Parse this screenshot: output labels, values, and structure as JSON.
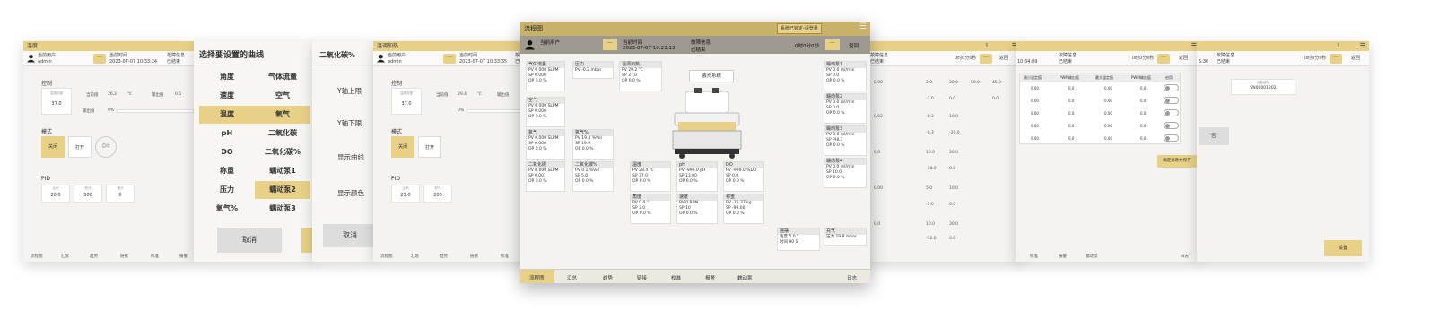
{
  "panel1": {
    "title": "温度",
    "user_label": "当前用户",
    "user": "admin",
    "time_label": "当前时间",
    "time": "2023-07-07 10:33:24",
    "fault_label": "故障信息",
    "fault": "已结束",
    "control_label": "控制",
    "setpoint_label": "温度设置",
    "setpoint": "37.0",
    "current_label": "当前值",
    "current": "26.2",
    "unit": "℃",
    "output_label": "输出值",
    "output": "0.0",
    "output2_label": "输出值",
    "output2": "0%",
    "mode_label": "模式",
    "mode_off": "关闭",
    "mode_on": "打开",
    "mode_auto": "自动",
    "pid_label": "PID",
    "pid_p_label": "比例",
    "pid_p": "20.0",
    "pid_i_label": "积分",
    "pid_i": "500",
    "pid_d_label": "微分",
    "pid_d": "0",
    "nav": [
      "流程图",
      "汇总",
      "趋势",
      "链接",
      "校准",
      "报警"
    ]
  },
  "curve_dialog": {
    "title": "选择要设置的曲线",
    "items": [
      "角度",
      "气体流量",
      "速度",
      "空气",
      "温度",
      "氧气",
      "pH",
      "二氧化碳",
      "DO",
      "二氧化碳%",
      "称重",
      "蠕动泵1",
      "压力",
      "蠕动泵2",
      "氧气%",
      "蠕动泵3"
    ],
    "cancel": "取消"
  },
  "axis_dialog": {
    "title": "二氧化碳%",
    "ymax_label": "Y轴上限",
    "ymin_label": "Y轴下限",
    "show_curve_label": "显示曲线",
    "color_label": "显示颜色",
    "cancel": "取消"
  },
  "panel3": {
    "title": "温调加热",
    "user_label": "当前用户",
    "user": "admin",
    "time_label": "当前时间",
    "time": "2023-07-07 10:33:35",
    "fault_label": "故障信息",
    "fault": "已结束",
    "control_label": "控制",
    "setpoint_label": "温度设置",
    "setpoint": "37.0",
    "current_label": "当前值",
    "current": "29.4",
    "unit": "℃",
    "output_label": "输出值",
    "output": "0%",
    "mode_label": "模式",
    "mode_off": "关闭",
    "mode_on": "打开",
    "pid_label": "PID",
    "pid_p_label": "比例",
    "pid_p": "25.0",
    "pid_i_label": "积分",
    "pid_i": "200",
    "nav": [
      "流程图",
      "汇总",
      "趋势",
      "链接",
      "校准"
    ]
  },
  "main": {
    "title": "流程图",
    "lock_button": "系统已锁定-请登录",
    "user_label": "当前用户",
    "time_label": "当前时间",
    "time": "2023-07-07 10:23:13",
    "fault_label": "故障信息",
    "fault": "已结束",
    "timer": "0时0分0秒",
    "back_button": "返回",
    "device_label": "激光系统",
    "gas_flow": {
      "title": "气体流量",
      "pv": "0.000",
      "sp": "0.000",
      "op": "0.0",
      "unit": "SLPM",
      "op_unit": "%"
    },
    "air": {
      "title": "空气",
      "pv": "0.000",
      "sp": "0.000",
      "op": "0.0",
      "unit": "SLPM",
      "op_unit": "%"
    },
    "oxygen": {
      "title": "氧气",
      "pv": "0.000",
      "sp": "0.000",
      "op": "0.0",
      "unit": "SLPM",
      "op_unit": "%"
    },
    "co2": {
      "title": "二氧化碳",
      "pv": "0.000",
      "sp": "0.001",
      "op": "0.0",
      "unit": "SLPM",
      "op_unit": "%"
    },
    "pressure": {
      "title": "压力",
      "pv": "-0.2",
      "unit": "mbar"
    },
    "oxygen_pct": {
      "title": "氧气%",
      "pv": "19.4",
      "sp": "19.9",
      "op": "0.0",
      "unit": "%Vol",
      "op_unit": "%"
    },
    "co2_pct": {
      "title": "二氧化碳%",
      "pv": "0.1",
      "sp": "5.0",
      "op": "0.0",
      "unit": "%Vol",
      "op_unit": "%"
    },
    "heating": {
      "title": "温调加热",
      "pv": "29.2",
      "sp": "37.0",
      "op": "0.0",
      "unit": "℃",
      "op_unit": "%"
    },
    "temp": {
      "title": "温度",
      "pv": "28.4",
      "sp": "37.0",
      "op": "0.0",
      "unit": "℃",
      "op_unit": "%"
    },
    "ph": {
      "title": "pH",
      "pv": "-999.0",
      "sp": "13.00",
      "op": "0.0",
      "unit": "pH",
      "op_unit": "%"
    },
    "do": {
      "title": "DO",
      "pv": "-999.0",
      "sp": "0.0",
      "op": "0.0",
      "unit": "%DO",
      "op_unit": "%"
    },
    "angle": {
      "title": "角度",
      "pv": "0.0",
      "sp": "3.0",
      "op": "0.0",
      "unit": "°",
      "op_unit": "%"
    },
    "speed": {
      "title": "速度",
      "pv": "0",
      "sp": "10",
      "op": "0.0",
      "unit": "RPM",
      "op_unit": "%"
    },
    "weight": {
      "title": "称重",
      "pv": "-15.37",
      "sp": "-99.00",
      "op": "0.0",
      "unit": "kg",
      "op_unit": "%"
    },
    "pump1": {
      "title": "蠕动泵1",
      "pv": "0.0",
      "sp": "0.0",
      "op": "0.0",
      "unit": "ml/min",
      "op_unit": "%"
    },
    "pump2": {
      "title": "蠕动泵2",
      "pv": "0.0",
      "sp": "0.0",
      "op": "0.0",
      "unit": "ml/min",
      "op_unit": "%"
    },
    "pump3": {
      "title": "蠕动泵3",
      "pv": "0.0",
      "sp": "PHL7",
      "op": "0.0",
      "unit": "ml/min",
      "op_unit": "%"
    },
    "pump4": {
      "title": "蠕动泵4",
      "pv": "0.0",
      "sp": "10.0",
      "op": "0.0",
      "unit": "ml/min",
      "op_unit": "%"
    },
    "rocking": {
      "title": "摇摆",
      "angle_label": "角度",
      "angle": "5.0",
      "angle_unit": "°",
      "time_label": "时间",
      "time": "90",
      "time_unit": "S"
    },
    "inflate": {
      "title": "充气",
      "pressure_label": "压力",
      "pressure": "19.8",
      "unit": "mbar"
    },
    "nav": [
      "流程图",
      "汇总",
      "趋势",
      "链接",
      "校准",
      "报警",
      "蠕动泵"
    ],
    "log": "日志"
  },
  "panel5": {
    "fault_label": "故障信息",
    "fault": "已结束",
    "timer": "0时0分0秒",
    "back": "返回",
    "rows": [
      [
        "0.00",
        "2.0",
        "30.0"
      ],
      [
        "0.02",
        "-2.0",
        "0.0"
      ],
      [
        "0.02",
        "-0.3",
        "10.0"
      ],
      [
        "",
        "-0.3",
        "-20.0"
      ],
      [
        "0.0",
        "10.0",
        "30.0"
      ],
      [
        "",
        "-10.0",
        "0.0"
      ],
      [
        "0.00",
        "5.0",
        "10.0"
      ],
      [
        "",
        "-5.0",
        "0.0"
      ],
      [
        "0.0",
        "10.0",
        "30.0"
      ],
      [
        "",
        "-10.0",
        "0.0"
      ]
    ],
    "extra1": "50.0",
    "extra2": "45.0",
    "extra3": "0.0"
  },
  "panel6": {
    "time": "10:34:09",
    "fault_label": "故障信息",
    "fault": "已结束",
    "timer": "0时0分0秒",
    "back": "返回",
    "headers": [
      "最小温定值",
      "PWM输出值",
      "最大温定值",
      "PWM输出值",
      "启用"
    ],
    "rows": [
      [
        "0.00",
        "0.0",
        "0.00",
        "0.0"
      ],
      [
        "0.00",
        "0.0",
        "0.00",
        "0.0"
      ],
      [
        "0.00",
        "0.0",
        "0.00",
        "0.0"
      ],
      [
        "0.00",
        "0.0",
        "0.00",
        "0.0"
      ],
      [
        "0.00",
        "0.0",
        "0.00",
        "0.0"
      ]
    ],
    "confirm": "确定修改并保存",
    "nav": [
      "校准",
      "报警",
      "蠕动泵"
    ],
    "log": "日志"
  },
  "panel7": {
    "time": "5:36",
    "fault_label": "故障信息",
    "fault": "已结束",
    "timer": "0时0分0秒",
    "back": "返回",
    "device_label": "设备编号",
    "device_id": "SN00001202",
    "side_btn": "否",
    "save": "设置"
  }
}
